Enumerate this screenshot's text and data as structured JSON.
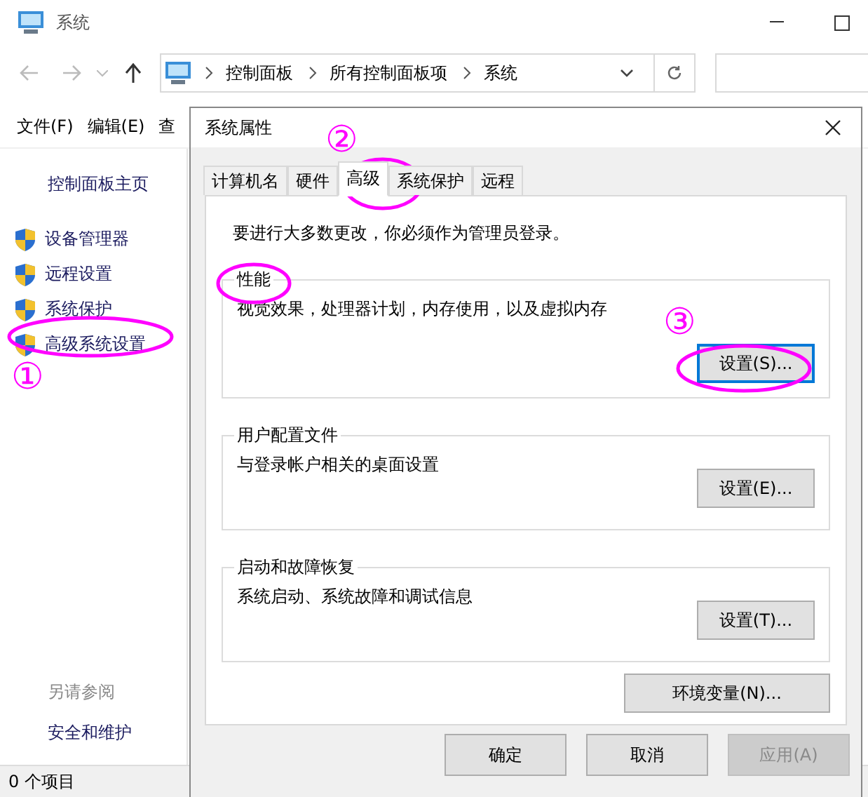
{
  "window": {
    "title": "系统"
  },
  "address": {
    "crumbs": [
      "控制面板",
      "所有控制面板项",
      "系统"
    ]
  },
  "menu": [
    "文件(F)",
    "编辑(E)",
    "查"
  ],
  "sidebar": {
    "home": "控制面板主页",
    "items": [
      "设备管理器",
      "远程设置",
      "系统保护",
      "高级系统设置"
    ],
    "see_also": "另请参阅",
    "links": [
      "安全和维护"
    ]
  },
  "status_bar": "0 个项目",
  "dialog": {
    "title": "系统属性",
    "tabs": [
      {
        "label": "计算机名",
        "selected": false
      },
      {
        "label": "硬件",
        "selected": false
      },
      {
        "label": "高级",
        "selected": true
      },
      {
        "label": "系统保护",
        "selected": false
      },
      {
        "label": "远程",
        "selected": false
      }
    ],
    "notice": "要进行大多数更改，你必须作为管理员登录。",
    "groups": [
      {
        "title": "性能",
        "description": "视觉效果，处理器计划，内存使用，以及虚拟内存",
        "button": {
          "label": "设置(S)...",
          "focused": true
        }
      },
      {
        "title": "用户配置文件",
        "description": "与登录帐户相关的桌面设置",
        "button": {
          "label": "设置(E)...",
          "focused": false
        }
      },
      {
        "title": "启动和故障恢复",
        "description": "系统启动、系统故障和调试信息",
        "button": {
          "label": "设置(T)...",
          "focused": false
        }
      }
    ],
    "env_button": "环境变量(N)...",
    "buttons": [
      {
        "label": "确定",
        "disabled": false
      },
      {
        "label": "取消",
        "disabled": false
      },
      {
        "label": "应用(A)",
        "disabled": true
      }
    ]
  },
  "annotations": [
    "①",
    "②",
    "③"
  ]
}
